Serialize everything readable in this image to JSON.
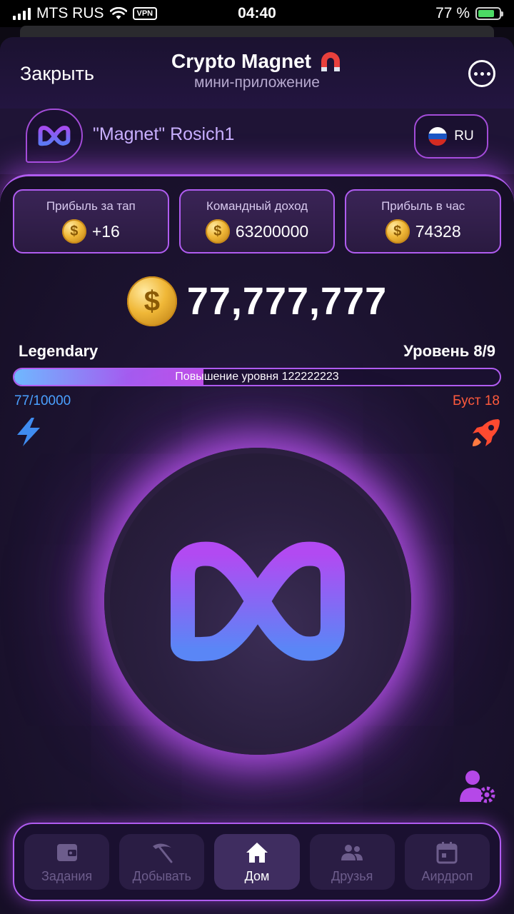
{
  "status_bar": {
    "carrier": "MTS RUS",
    "vpn": "VPN",
    "time": "04:40",
    "battery": "77 %",
    "battery_level": 0.77
  },
  "header": {
    "close_label": "Закрыть",
    "title": "Crypto Magnet",
    "subtitle": "мини-приложение"
  },
  "profile": {
    "username": "\"Magnet\" Rosich1",
    "language": "RU"
  },
  "stats": [
    {
      "label": "Прибыль за тап",
      "value": "+16"
    },
    {
      "label": "Командный доход",
      "value": "63200000"
    },
    {
      "label": "Прибыль в час",
      "value": "74328"
    }
  ],
  "balance": "77,777,777",
  "rank": "Legendary",
  "level": "Уровень 8/9",
  "level_progress": {
    "text": "Повышение уровня 122222223",
    "fraction": 0.39
  },
  "energy": "77/10000",
  "boost": "Буст 18",
  "colors": {
    "accent": "#b05cf0",
    "energy": "#4aa0ff",
    "boost": "#ff5a3c"
  },
  "nav": [
    {
      "label": "Задания",
      "icon": "wallet-icon",
      "active": false
    },
    {
      "label": "Добывать",
      "icon": "pickaxe-icon",
      "active": false
    },
    {
      "label": "Дом",
      "icon": "home-icon",
      "active": true
    },
    {
      "label": "Друзья",
      "icon": "friends-icon",
      "active": false
    },
    {
      "label": "Аирдроп",
      "icon": "calendar-icon",
      "active": false
    }
  ]
}
